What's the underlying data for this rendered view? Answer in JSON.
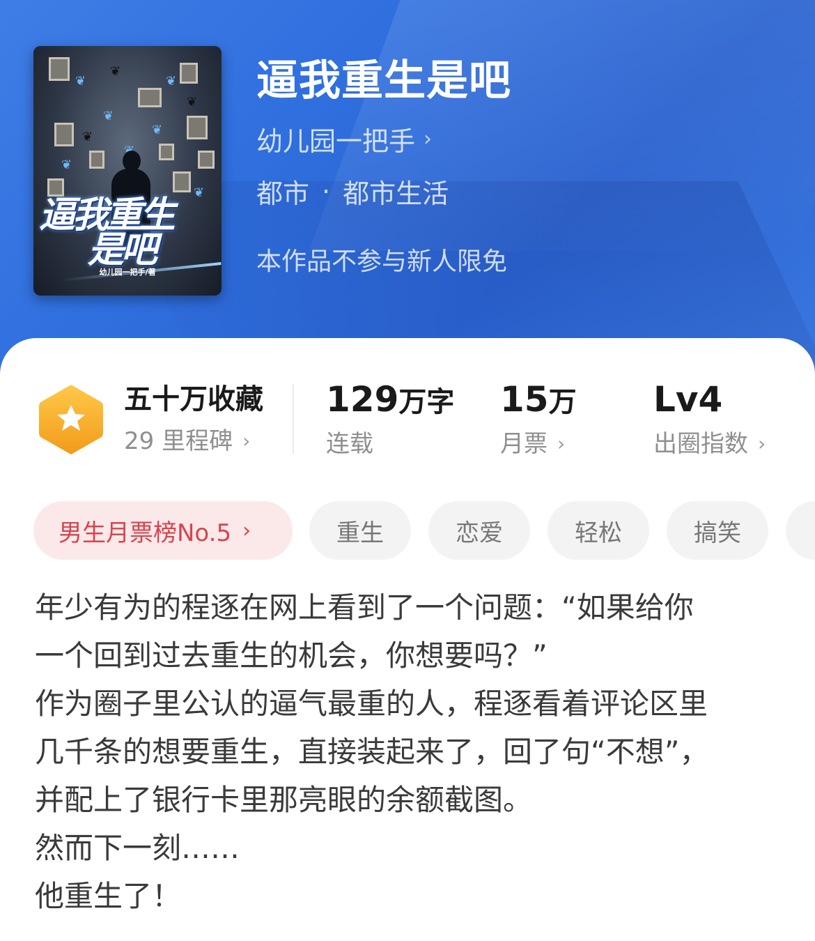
{
  "book": {
    "title": "逼我重生是吧",
    "author": "幼儿园一把手",
    "category": "都市",
    "subcategory": "都市生活",
    "genre_separator": "·",
    "promo_note": "本作品不参与新人限免",
    "cover": {
      "title_line1": "逼我重生",
      "title_line2": "是吧",
      "author_caption": "幼儿园一把手/著"
    }
  },
  "stats": {
    "collection": {
      "value": "五十万收藏",
      "sub": "29 里程碑"
    },
    "words": {
      "number": "129",
      "unit": "万字",
      "sub": "连载"
    },
    "monthly_votes": {
      "number": "15",
      "unit": "万",
      "sub": "月票"
    },
    "level": {
      "value": "Lv4",
      "sub": "出圈指数"
    }
  },
  "tags": {
    "rank": "男生月票榜No.5",
    "items": [
      "重生",
      "恋爱",
      "轻松",
      "搞笑"
    ]
  },
  "description": {
    "lines": [
      "年少有为的程逐在网上看到了一个问题：“如果给你",
      "一个回到过去重生的机会，你想要吗？”",
      "作为圈子里公认的逼气最重的人，程逐看着评论区里",
      "几千条的想要重生，直接装起来了，回了句“不想”，",
      "并配上了银行卡里那亮眼的余额截图。",
      "然而下一刻……",
      "他重生了！"
    ]
  },
  "colors": {
    "hero_blue": "#2f6fde",
    "badge_orange": "#f5a623",
    "rank_red": "#d9434b",
    "rank_bg": "#fbe9ea"
  },
  "icons": {
    "author_chevron": "chevron-right-icon",
    "milestone_badge": "star-hexagon-icon"
  }
}
